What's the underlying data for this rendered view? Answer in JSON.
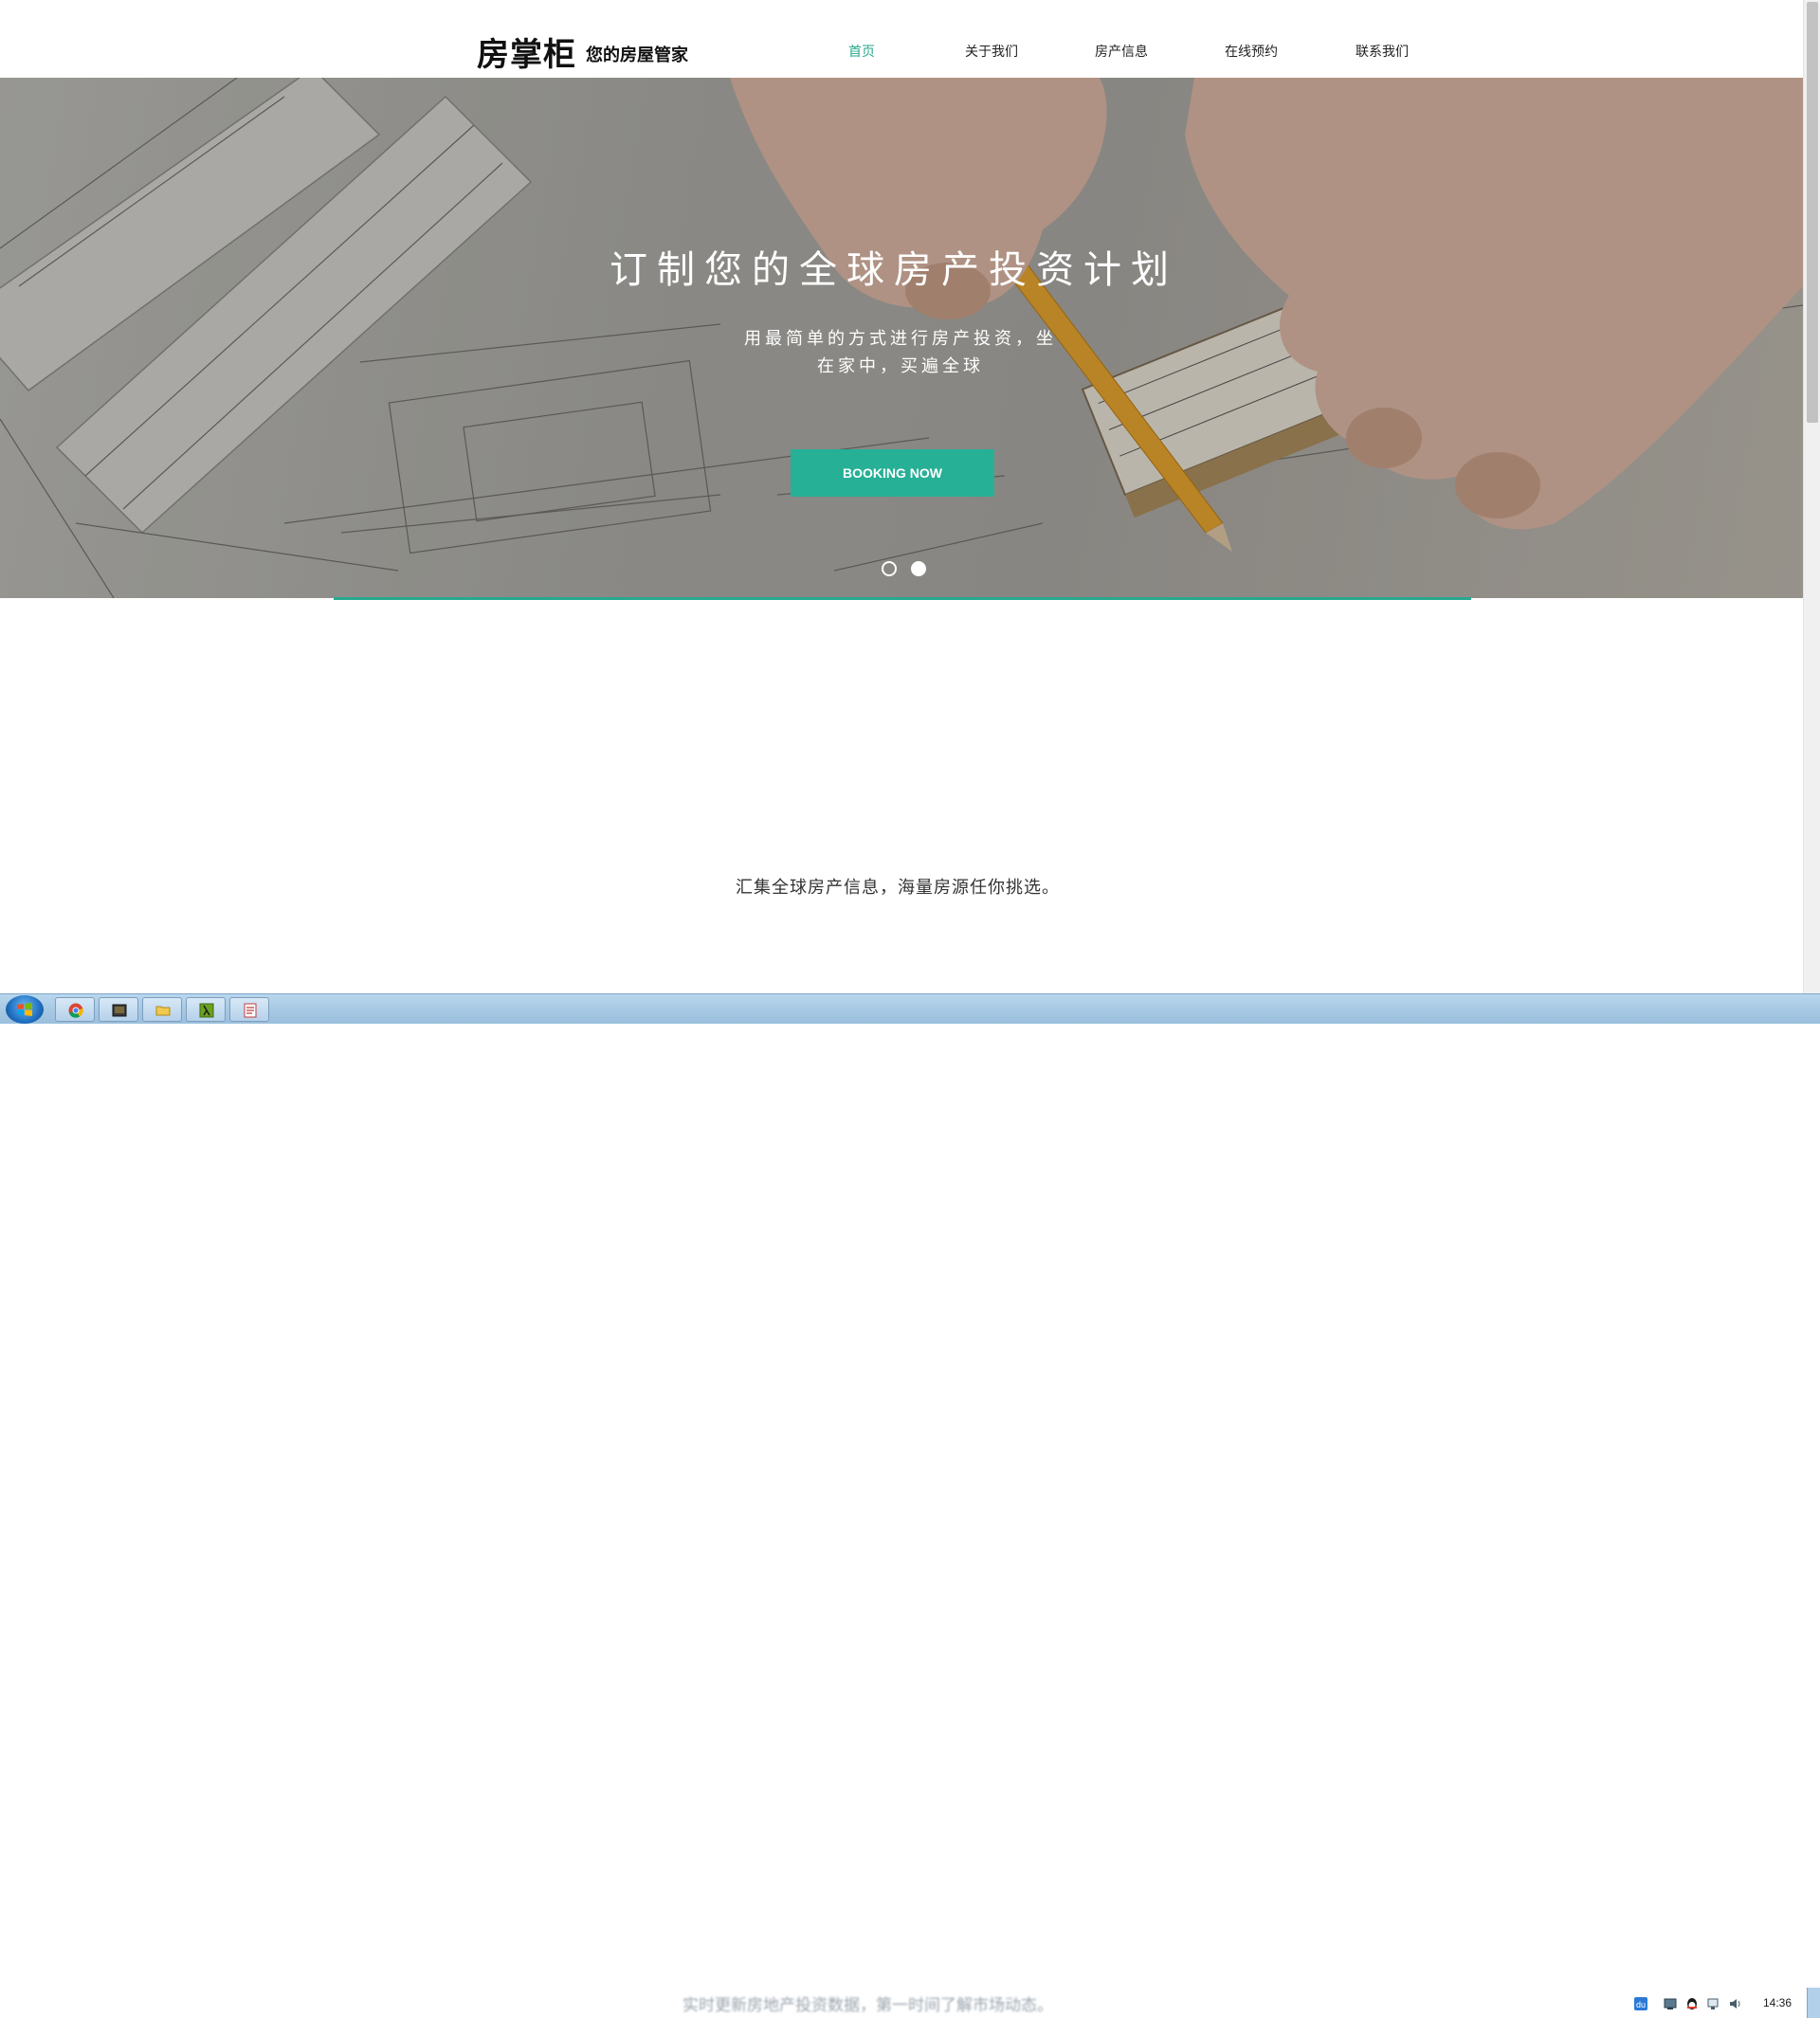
{
  "header": {
    "logo": "房掌柜",
    "slogan": "您的房屋管家",
    "nav": [
      {
        "label": "首页",
        "active": true
      },
      {
        "label": "关于我们",
        "active": false
      },
      {
        "label": "房产信息",
        "active": false
      },
      {
        "label": "在线预约",
        "active": false
      },
      {
        "label": "联系我们",
        "active": false
      }
    ]
  },
  "hero": {
    "title": "订制您的全球房产投资计划",
    "subtitle_line1": "用最简单的方式进行房产投资，坐",
    "subtitle_line2": "在家中，买遍全球",
    "button_label": "BOOKING NOW",
    "carousel_active_index": 1,
    "carousel_count": 2
  },
  "content": {
    "intro_text": "汇集全球房产信息，海量房源任你挑选。"
  },
  "taskbar": {
    "marquee_text": "实时更新房地产投资数据，第一时间了解市场动态。",
    "apps": [
      "chrome-icon",
      "terminal-icon",
      "file-explorer-icon",
      "lambda-app-icon",
      "foxit-reader-icon"
    ],
    "tray": [
      "du-icon",
      "network-manager-icon",
      "qq-icon",
      "network-icon",
      "volume-icon"
    ],
    "clock": "14:36"
  },
  "colors": {
    "accent": "#27a98e",
    "button": "#26b096"
  }
}
